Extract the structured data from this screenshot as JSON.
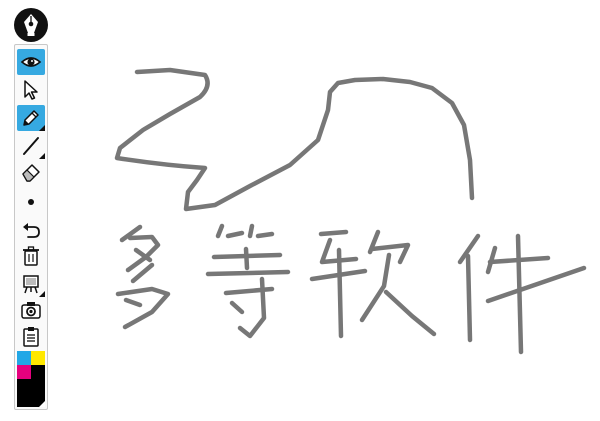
{
  "app": {
    "colors": {
      "accent": "#36a9e1",
      "toolbar_bg": "#fafafa",
      "stroke": "#777777"
    }
  },
  "logo": {
    "icon": "pen-nib-icon"
  },
  "toolbar": {
    "tools": [
      {
        "name": "view",
        "icon": "eye-icon",
        "active": true
      },
      {
        "name": "select",
        "icon": "cursor-arrow-icon",
        "active": false
      },
      {
        "name": "pencil",
        "icon": "pencil-icon",
        "active": true
      },
      {
        "name": "line",
        "icon": "line-icon",
        "active": false
      },
      {
        "name": "eraser",
        "icon": "eraser-icon",
        "active": false
      },
      {
        "name": "brush-size",
        "icon": "dot-icon",
        "active": false
      },
      {
        "name": "undo",
        "icon": "undo-icon",
        "active": false
      },
      {
        "name": "clear",
        "icon": "trash-icon",
        "active": false
      },
      {
        "name": "background",
        "icon": "easel-icon",
        "active": false
      },
      {
        "name": "snapshot",
        "icon": "camera-icon",
        "active": false
      },
      {
        "name": "export",
        "icon": "clipboard-icon",
        "active": false
      }
    ],
    "palette": {
      "colors": [
        "#22a7e6",
        "#ffe800",
        "#e6007e",
        "#000000"
      ],
      "selected": "#000000"
    }
  },
  "drawing": {
    "handwritten_text": "多等软件"
  }
}
